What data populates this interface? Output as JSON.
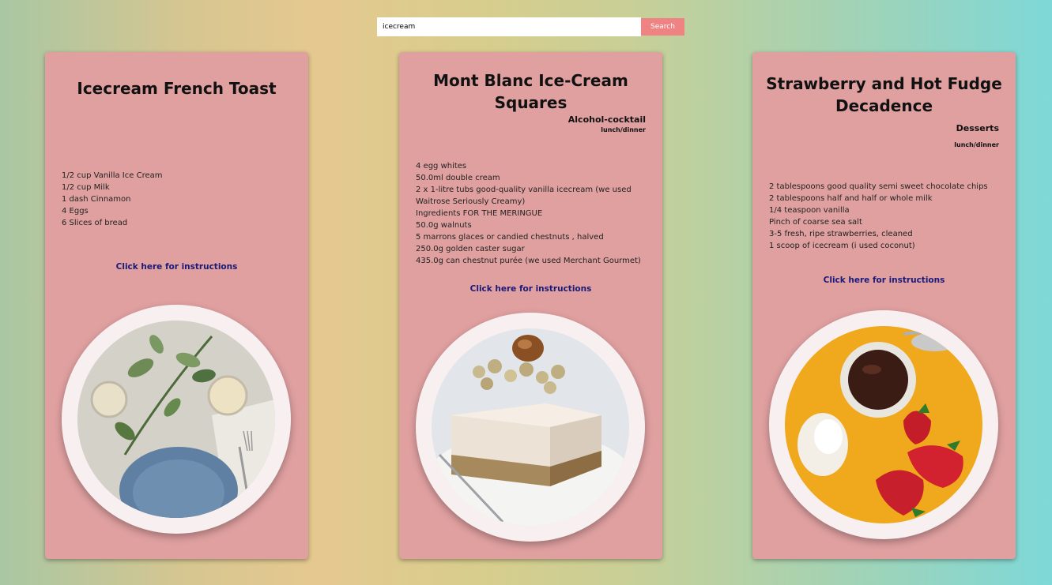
{
  "search": {
    "value": "icecream",
    "button_label": "Search"
  },
  "cards": [
    {
      "title": "Icecream French Toast",
      "category": "",
      "meal": "",
      "ingredients": [
        "1/2 cup Vanilla Ice Cream",
        "1/2 cup Milk",
        "1 dash Cinnamon",
        "4 Eggs",
        "6 Slices of bread"
      ],
      "link_label": "Click here for instructions",
      "image_icon": "table-setting-photo"
    },
    {
      "title": "Mont Blanc Ice-Cream Squares",
      "category": "Alcohol-cocktail",
      "meal": "lunch/dinner",
      "ingredients": [
        "4 egg whites",
        "50.0ml double cream",
        "2 x 1-litre tubs good-quality vanilla icecream (we used",
        "Waitrose Seriously Creamy)",
        "Ingredients FOR THE MERINGUE",
        "50.0g walnuts",
        "5 marrons glaces or candied chestnuts , halved",
        "250.0g golden caster sugar",
        "435.0g can chestnut purée (we used Merchant Gourmet)"
      ],
      "link_label": "Click here for instructions",
      "image_icon": "ice-cream-square-photo"
    },
    {
      "title": "Strawberry and Hot Fudge Decadence",
      "category": "Desserts",
      "meal": "lunch/dinner",
      "ingredients": [
        "2 tablespoons good quality semi sweet chocolate chips",
        "2 tablespoons half and half or whole milk",
        "1/4 teaspoon vanilla",
        "Pinch of coarse sea salt",
        "3-5 fresh, ripe strawberries, cleaned",
        "1 scoop of icecream (i used coconut)"
      ],
      "link_label": "Click here for instructions",
      "image_icon": "strawberry-fudge-photo"
    }
  ],
  "colors": {
    "card": "#e0a0a0",
    "button": "#ef8383",
    "link": "#1a1a7a",
    "plate": "#f8f0f0"
  }
}
